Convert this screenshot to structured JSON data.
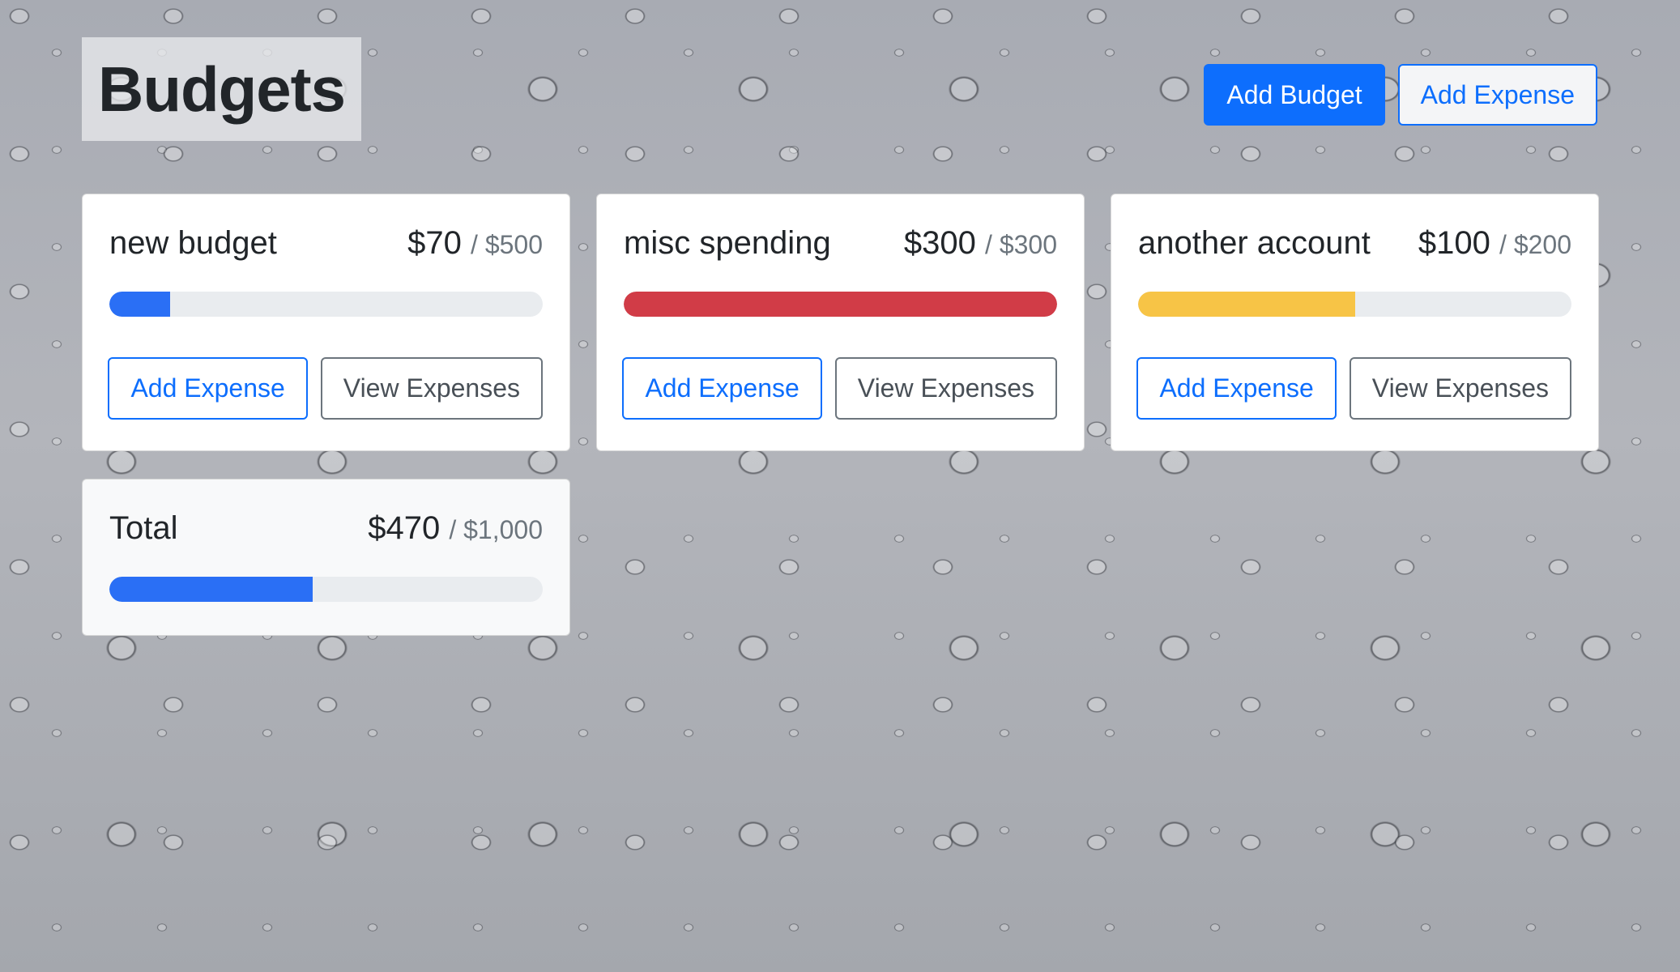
{
  "page": {
    "title": "Budgets"
  },
  "header": {
    "add_budget_label": "Add Budget",
    "add_expense_label": "Add Expense"
  },
  "colors": {
    "primary": "#0d6efd",
    "danger": "#d13c47",
    "warning": "#f7c446",
    "track": "#e9ecef"
  },
  "budgets": [
    {
      "name": "new budget",
      "amount": "$70",
      "max": "/ $500",
      "progress_fraction": 0.14,
      "progress_color": "#2a6ff5",
      "add_expense_label": "Add Expense",
      "view_expenses_label": "View Expenses"
    },
    {
      "name": "misc spending",
      "amount": "$300",
      "max": "/ $300",
      "progress_fraction": 1.0,
      "progress_color": "#d13c47",
      "add_expense_label": "Add Expense",
      "view_expenses_label": "View Expenses"
    },
    {
      "name": "another account",
      "amount": "$100",
      "max": "/ $200",
      "progress_fraction": 0.5,
      "progress_color": "#f7c446",
      "add_expense_label": "Add Expense",
      "view_expenses_label": "View Expenses"
    }
  ],
  "total": {
    "name": "Total",
    "amount": "$470",
    "max": "/ $1,000",
    "progress_fraction": 0.47,
    "progress_color": "#2a6ff5"
  }
}
